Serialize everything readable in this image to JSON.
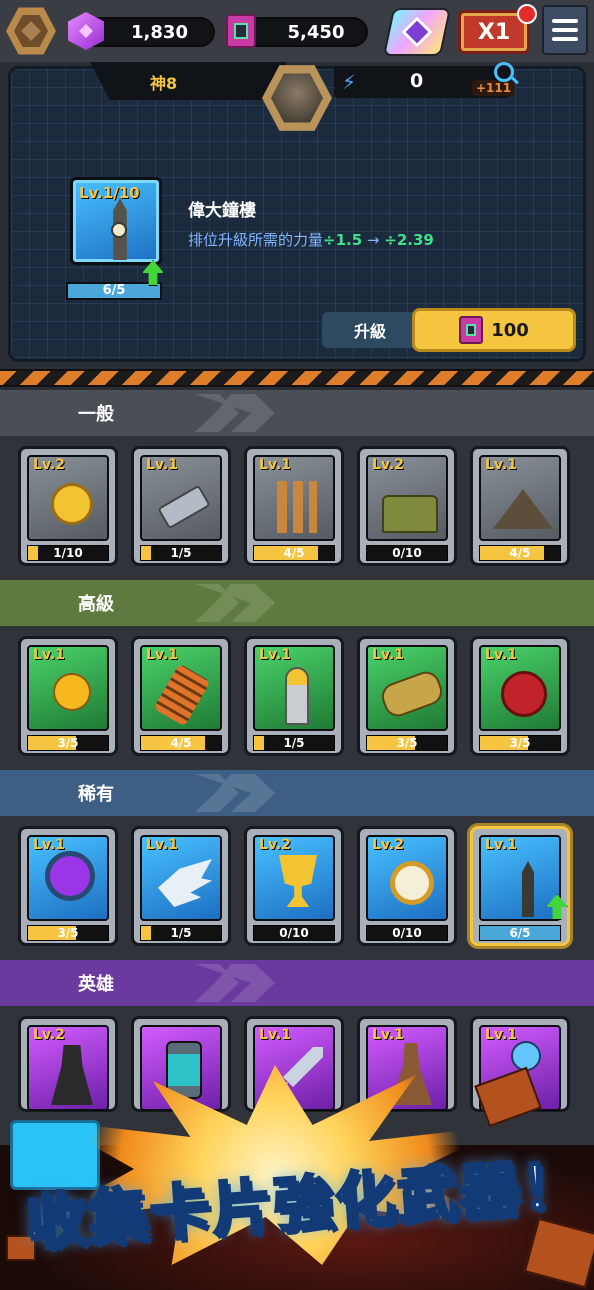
{
  "topbar": {
    "gems": "1,830",
    "books": "5,450",
    "speed": "X1"
  },
  "detail": {
    "rank": "神8",
    "power": "0",
    "power_bonus": "+111",
    "card_level": "Lv.1/10",
    "card_progress": "6/5",
    "card_progress_fraction": 1.0,
    "name": "偉大鐘樓",
    "desc_prefix": "排位升級所需的力量",
    "desc_from": "÷1.5",
    "desc_arrow": " → ",
    "desc_to": "÷2.39",
    "upgrade_tab": "升級",
    "upgrade_cost": "100"
  },
  "sections": {
    "normal": "一般",
    "advanced": "高級",
    "rare": "稀有",
    "hero": "英雄"
  },
  "cards": {
    "normal": [
      {
        "level": "Lv.2",
        "progress": "1/10",
        "fraction": 0.1,
        "icon": "gold-coin-icon"
      },
      {
        "level": "Lv.1",
        "progress": "1/5",
        "fraction": 0.2,
        "icon": "gun-barrel-icon"
      },
      {
        "level": "Lv.1",
        "progress": "4/5",
        "fraction": 0.8,
        "icon": "bullets-icon"
      },
      {
        "level": "Lv.2",
        "progress": "0/10",
        "fraction": 0.0,
        "icon": "sandbags-icon"
      },
      {
        "level": "Lv.1",
        "progress": "4/5",
        "fraction": 0.8,
        "icon": "gunpowder-pile-icon"
      }
    ],
    "advanced": [
      {
        "level": "Lv.1",
        "progress": "3/5",
        "fraction": 0.6,
        "icon": "golden-apple-icon"
      },
      {
        "level": "Lv.1",
        "progress": "4/5",
        "fraction": 0.8,
        "icon": "spring-coil-icon"
      },
      {
        "level": "Lv.1",
        "progress": "1/5",
        "fraction": 0.2,
        "icon": "shell-icon"
      },
      {
        "level": "Lv.1",
        "progress": "3/5",
        "fraction": 0.6,
        "icon": "cannon-icon"
      },
      {
        "level": "Lv.1",
        "progress": "3/5",
        "fraction": 0.6,
        "icon": "wax-seal-icon"
      }
    ],
    "rare": [
      {
        "level": "Lv.1",
        "progress": "3/5",
        "fraction": 0.6,
        "icon": "magnifier-orb-icon"
      },
      {
        "level": "Lv.1",
        "progress": "1/5",
        "fraction": 0.2,
        "icon": "wing-icon"
      },
      {
        "level": "Lv.2",
        "progress": "0/10",
        "fraction": 0.0,
        "icon": "trophy-icon"
      },
      {
        "level": "Lv.2",
        "progress": "0/10",
        "fraction": 0.0,
        "icon": "pocket-watch-icon"
      },
      {
        "level": "Lv.1",
        "progress": "6/5",
        "fraction": 1.0,
        "icon": "clock-tower-icon"
      }
    ],
    "hero": [
      {
        "level": "Lv.2",
        "icon": "gentleman-icon"
      },
      {
        "level": "",
        "icon": "canister-icon"
      },
      {
        "level": "Lv.1",
        "icon": "sword-icon"
      },
      {
        "level": "Lv.1",
        "icon": "gunslinger-icon"
      },
      {
        "level": "Lv.1",
        "icon": "orb-icon"
      }
    ]
  },
  "promo": {
    "title": "收集卡片強化武器！"
  },
  "colors": {
    "gold": "#f5c542",
    "green_text": "#3fe08a",
    "blue_text": "#7fb6ff",
    "normal_bar": "#4a4e55",
    "advanced_bar": "#5f7a3e",
    "rare_bar": "#3d5f84",
    "hero_bar": "#6a3a9e"
  }
}
